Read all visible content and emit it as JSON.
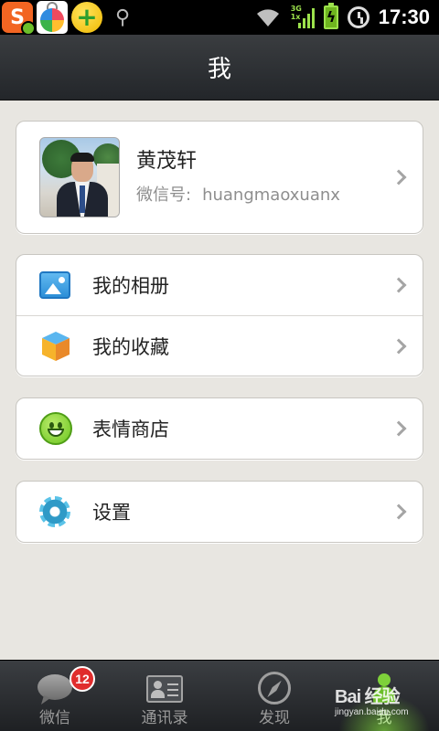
{
  "status_bar": {
    "notification_icons": [
      "sogou-input-icon",
      "shopping-bag-icon",
      "plus-app-icon",
      "usb-icon"
    ],
    "network_label": "3G\n1x",
    "time": "17:30"
  },
  "header": {
    "title": "我"
  },
  "profile": {
    "name": "黄茂轩",
    "wechat_id_label": "微信号:",
    "wechat_id": "huangmaoxuanx"
  },
  "menu": {
    "album": "我的相册",
    "favorites": "我的收藏",
    "sticker_shop": "表情商店",
    "settings": "设置"
  },
  "tabs": [
    {
      "label": "微信",
      "badge": "12",
      "icon": "chat-icon"
    },
    {
      "label": "通讯录",
      "icon": "contacts-icon"
    },
    {
      "label": "发现",
      "icon": "compass-icon"
    },
    {
      "label": "我",
      "icon": "person-icon",
      "active": true
    }
  ],
  "watermark": {
    "main": "Bai 经验",
    "sub": "jingyan.baidu.com"
  },
  "colors": {
    "background": "#e8e6e1",
    "header": "#2c2f33",
    "tab_active": "#6cbf2a",
    "badge": "#e02d2d"
  }
}
